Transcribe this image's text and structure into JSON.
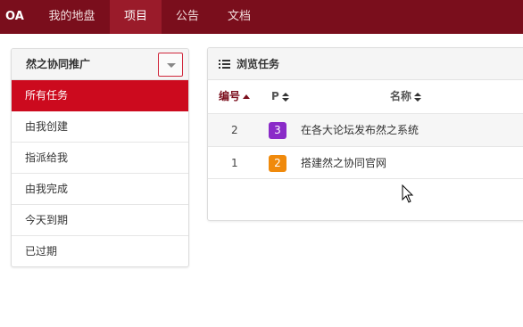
{
  "nav": {
    "brand": "OA",
    "items": [
      {
        "label": "我的地盘",
        "active": false
      },
      {
        "label": "项目",
        "active": true
      },
      {
        "label": "公告",
        "active": false
      },
      {
        "label": "文档",
        "active": false
      }
    ]
  },
  "project_panel": {
    "title": "然之协同推广",
    "dropdown_icon": "caret-down-icon",
    "items": [
      {
        "label": "所有任务",
        "active": true
      },
      {
        "label": "由我创建",
        "active": false
      },
      {
        "label": "指派给我",
        "active": false
      },
      {
        "label": "由我完成",
        "active": false
      },
      {
        "label": "今天到期",
        "active": false
      },
      {
        "label": "已过期",
        "active": false
      }
    ]
  },
  "task_panel": {
    "title": "浏览任务",
    "icon": "list-icon",
    "columns": {
      "id": "编号",
      "pri": "P",
      "name": "名称"
    },
    "rows": [
      {
        "id": "2",
        "pri": "3",
        "pri_color": "#8a2bc8",
        "name": "在各大论坛发布然之系统"
      },
      {
        "id": "1",
        "pri": "2",
        "pri_color": "#f08a0c",
        "name": "搭建然之协同官网"
      }
    ]
  },
  "colors": {
    "nav_bg": "#7a0e1c",
    "accent": "#cc0a1e"
  }
}
